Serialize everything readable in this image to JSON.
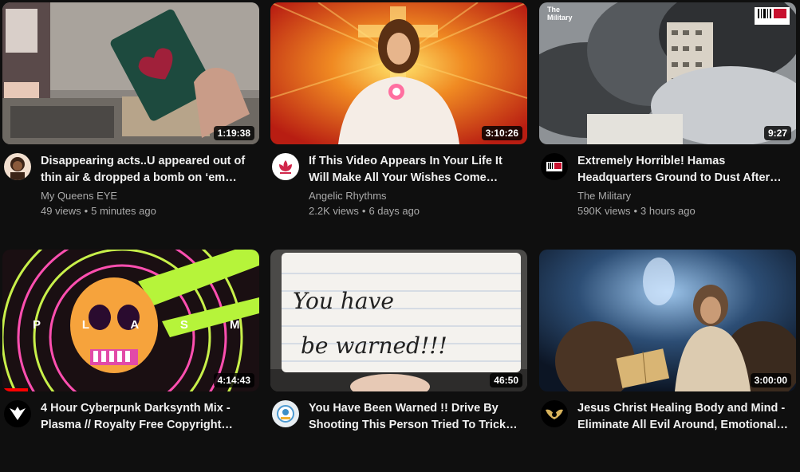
{
  "videos": [
    {
      "title": "Disappearing acts..U appeared out of thin air & dropped a bomb on ‘em…",
      "channel": "My Queens EYE",
      "views": "49 views",
      "age": "5 minutes ago",
      "duration": "1:19:38"
    },
    {
      "title": "If This Video Appears In Your Life It Will Make All Your Wishes Come…",
      "channel": "Angelic Rhythms",
      "views": "2.2K views",
      "age": "6 days ago",
      "duration": "3:10:26"
    },
    {
      "title": "Extremely Horrible! Hamas Headquarters Ground to Dust After…",
      "channel": "The Military",
      "views": "590K views",
      "age": "3 hours ago",
      "duration": "9:27",
      "thumb_label": "The Military"
    },
    {
      "title": "4 Hour Cyberpunk Darksynth Mix - Plasma // Royalty Free Copyright…",
      "channel": "",
      "views": "",
      "age": "",
      "duration": "4:14:43",
      "thumb_text": "P L A S M A",
      "progress": 0.1
    },
    {
      "title": "You Have Been Warned !! Drive By Shooting This Person Tried To Trick…",
      "channel": "",
      "views": "",
      "age": "",
      "duration": "46:50",
      "thumb_text_1": "You have",
      "thumb_text_2": "be warned!!!"
    },
    {
      "title": "Jesus Christ Healing Body and Mind - Eliminate All Evil Around, Emotional…",
      "channel": "",
      "views": "",
      "age": "",
      "duration": "3:00:00"
    }
  ],
  "colors": {
    "background": "#0f0f0f",
    "secondary_text": "#aaaaaa",
    "progress": "#ff0000"
  }
}
